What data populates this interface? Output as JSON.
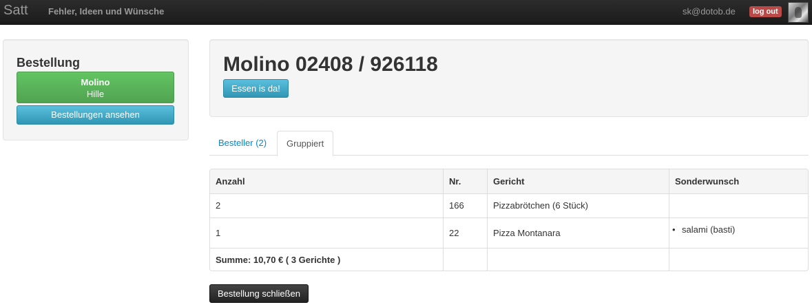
{
  "navbar": {
    "brand": "Satt",
    "link": "Fehler, Ideen und Wünsche",
    "user_email": "sk@dotob.de",
    "logout_label": "log out"
  },
  "sidebar": {
    "title": "Bestellung",
    "order_button": {
      "name": "Molino",
      "location": "Hille"
    },
    "view_orders_label": "Bestellungen ansehen"
  },
  "main": {
    "title": "Molino 02408 / 926118",
    "arrived_button": "Essen is da!",
    "tabs": [
      {
        "label": "Besteller (2)",
        "active": false
      },
      {
        "label": "Gruppiert",
        "active": true
      }
    ],
    "table": {
      "headers": [
        "Anzahl",
        "Nr.",
        "Gericht",
        "Sonderwunsch"
      ],
      "rows": [
        {
          "anzahl": "2",
          "nr": "166",
          "gericht": "Pizzabrötchen (6 Stück)",
          "sonderwunsch": []
        },
        {
          "anzahl": "1",
          "nr": "22",
          "gericht": "Pizza Montanara",
          "sonderwunsch": [
            "salami (basti)"
          ]
        }
      ],
      "summary": "Summe: 10,70 € ( 3 Gerichte )"
    },
    "close_button": "Bestellung schließen"
  },
  "colors": {
    "navbar": "#1b1b1b",
    "success": "#51a351",
    "info": "#2f96b4",
    "danger": "#b94a48",
    "link": "#0088cc"
  }
}
